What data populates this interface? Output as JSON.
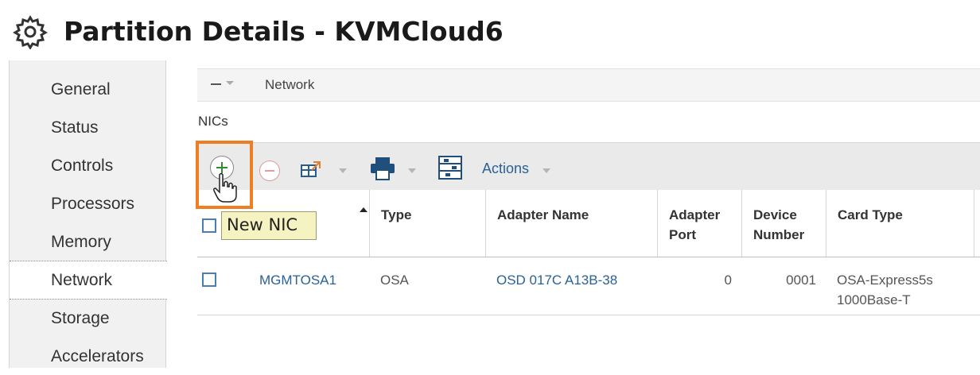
{
  "page": {
    "title": "Partition Details - KVMCloud6",
    "title_icon": "gear-icon"
  },
  "nav": {
    "items": [
      {
        "label": "General"
      },
      {
        "label": "Status"
      },
      {
        "label": "Controls"
      },
      {
        "label": "Processors"
      },
      {
        "label": "Memory"
      },
      {
        "label": "Network",
        "active": true
      },
      {
        "label": "Storage"
      },
      {
        "label": "Accelerators"
      }
    ]
  },
  "section": {
    "title": "Network",
    "subtitle": "NICs"
  },
  "toolbar": {
    "new_icon": "add-circle-icon",
    "delete_icon": "remove-circle-icon",
    "export_icon": "export-table-icon",
    "print_icon": "printer-icon",
    "configure_icon": "configure-columns-icon",
    "actions_label": "Actions",
    "tooltip": "New NIC",
    "highlight_color": "#ef7d22"
  },
  "table": {
    "columns": [
      {
        "label": ""
      },
      {
        "label": "Type"
      },
      {
        "label": "Adapter Name"
      },
      {
        "label": "Adapter Port"
      },
      {
        "label": "Device Number"
      },
      {
        "label": "Card Type"
      }
    ],
    "rows": [
      {
        "name": "MGMTOSA1",
        "type": "OSA",
        "adapter_name": "OSD 017C A13B-38",
        "adapter_port": "0",
        "device_number": "0001",
        "card_type": "OSA-Express5s 1000Base-T"
      }
    ]
  },
  "colors": {
    "link": "#2a6196",
    "nav_bg": "#f1f1f1",
    "toolbar_bg": "#eaeaea",
    "tooltip_bg": "#f5f3c2"
  }
}
